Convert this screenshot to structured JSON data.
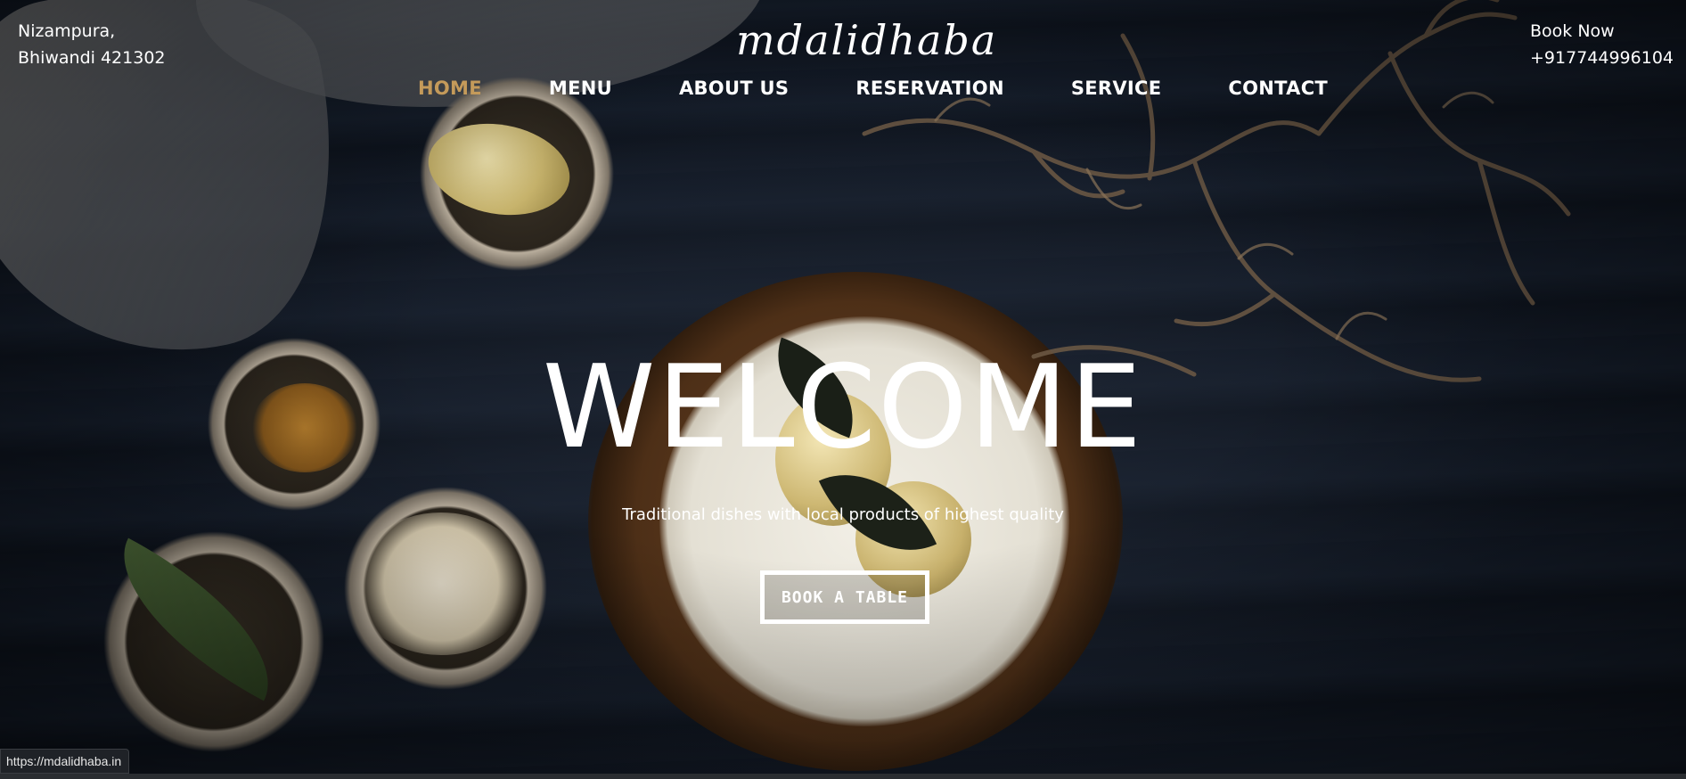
{
  "header": {
    "address_line1": "Nizampura,",
    "address_line2": "Bhiwandi 421302",
    "logo": "mdalidhaba",
    "book_now_label": "Book Now",
    "phone": "+917744996104"
  },
  "nav": {
    "items": [
      {
        "label": "HOME",
        "active": true
      },
      {
        "label": "MENU",
        "active": false
      },
      {
        "label": "ABOUT US",
        "active": false
      },
      {
        "label": "RESERVATION",
        "active": false
      },
      {
        "label": "SERVICE",
        "active": false
      },
      {
        "label": "CONTACT",
        "active": false
      }
    ]
  },
  "hero": {
    "title": "WELCOME",
    "tagline": "Traditional dishes with local products of highest quality",
    "cta_label": "BOOK A TABLE"
  },
  "status_bar": {
    "url": "https://mdalidhaba.in"
  },
  "colors": {
    "accent": "#c49a5a",
    "text": "#ffffff",
    "background": "#0f1520"
  }
}
